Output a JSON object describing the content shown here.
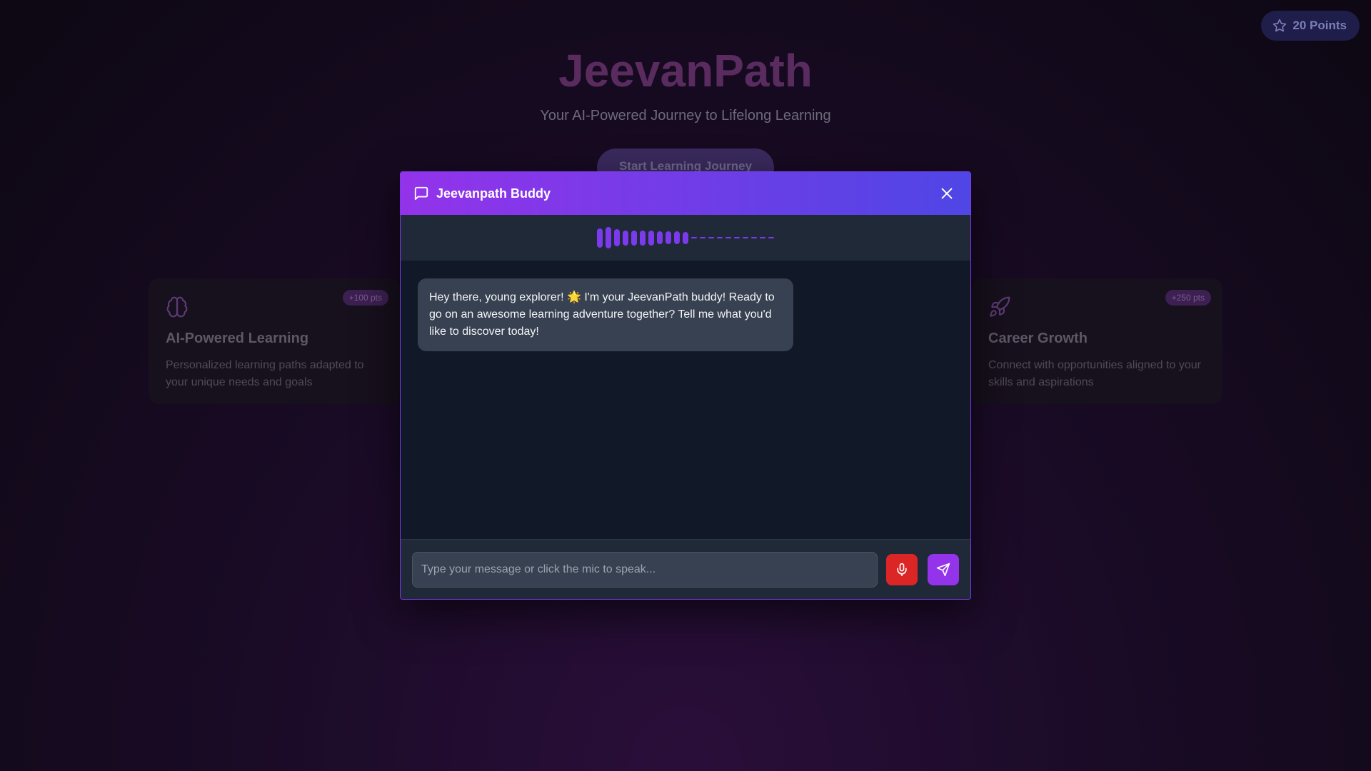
{
  "header": {
    "points_label": "20 Points",
    "icon": "star-icon"
  },
  "hero": {
    "title": "JeevanPath",
    "subtitle": "Your AI-Powered Journey to Lifelong Learning",
    "cta_label": "Start Learning Journey"
  },
  "cards": [
    {
      "icon": "brain-icon",
      "badge": "+100 pts",
      "title": "AI-Powered Learning",
      "description": "Personalized learning paths adapted to your unique needs and goals"
    },
    {
      "icon": "rocket-icon",
      "badge": "+250 pts",
      "title": "Career Growth",
      "description": "Connect with opportunities aligned to your skills and aspirations"
    }
  ],
  "chat": {
    "title": "Jeevanpath Buddy",
    "header_icon": "message-square-icon",
    "close_icon": "close-icon",
    "visualizer": {
      "bar_levels": [
        0.9,
        1.0,
        0.8,
        0.7,
        0.7,
        0.7,
        0.7,
        0.6,
        0.6,
        0.6,
        0.55
      ],
      "idle_segments": 10,
      "color": "#7c3aed"
    },
    "messages": [
      {
        "sender": "bot",
        "text": "Hey there, young explorer! 🌟 I'm your JeevanPath buddy! Ready to go on an awesome learning adventure together? Tell me what you'd like to discover today!"
      }
    ],
    "input": {
      "value": "",
      "placeholder": "Type your message or click the mic to speak..."
    },
    "mic_icon": "mic-icon",
    "send_icon": "send-icon"
  },
  "colors": {
    "accent": "#9333ea",
    "accent_secondary": "#4f46e5",
    "mic": "#dc2626"
  }
}
